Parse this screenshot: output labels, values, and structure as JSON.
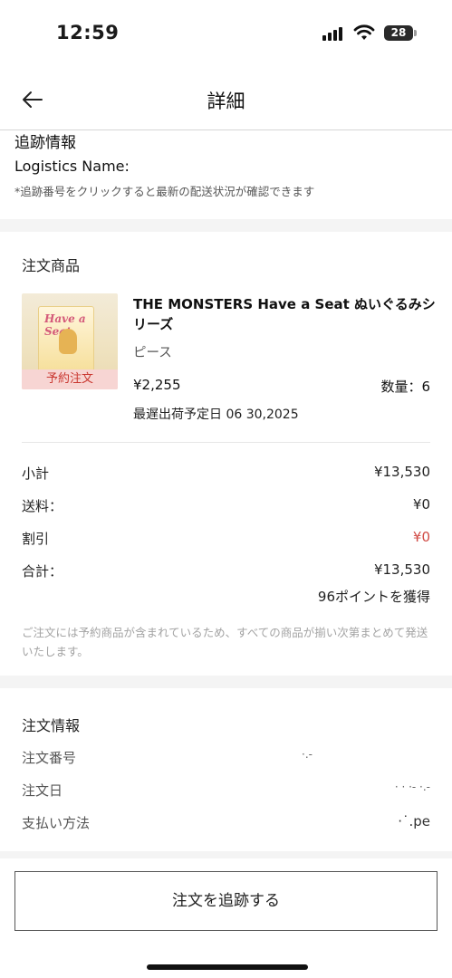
{
  "status_bar": {
    "time": "12:59",
    "battery_level": "28",
    "icons": [
      "signal-icon",
      "wifi-icon",
      "battery-icon"
    ]
  },
  "nav": {
    "title": "詳細",
    "back_icon": "arrow-left-icon"
  },
  "tracking": {
    "title": "追跡情報",
    "logistics_label": "Logistics Name:",
    "note": "*追跡番号をクリックすると最新の配送状況が確認できます"
  },
  "order_items": {
    "section_title": "注文商品",
    "product": {
      "badge": "予約注文",
      "name": "THE MONSTERS Have a Seat ぬいぐるみシリーズ",
      "variant": "ピース",
      "price": "¥2,255",
      "quantity": "数量：6",
      "ship_date": "最遅出荷予定日 06 30,2025",
      "thumb_text": "Have a Seat"
    }
  },
  "summary": {
    "rows": [
      {
        "label": "小計",
        "value": "¥13,530",
        "highlight": false
      },
      {
        "label": "送料：",
        "value": "¥0",
        "highlight": false
      },
      {
        "label": "割引",
        "value": "¥0",
        "highlight": true
      },
      {
        "label": "合計：",
        "value": "¥13,530",
        "highlight": false
      }
    ],
    "points": "96ポイントを獲得",
    "note": "ご注文には予約商品が含まれているため、すべての商品が揃い次第まとめて発送いたします。"
  },
  "order_info": {
    "section_title": "注文情報",
    "rows": [
      {
        "label": "注文番号",
        "value": "·.-"
      },
      {
        "label": "注文日",
        "value": "· · ·- ·.-"
      },
      {
        "label": "支払い方法",
        "value": "·˙.pe"
      }
    ]
  },
  "action": {
    "track_button": "注文を追跡する"
  },
  "colors": {
    "accent_red": "#d04a44",
    "badge_bg": "#f7d5d3",
    "divider": "#f4f4f4"
  }
}
